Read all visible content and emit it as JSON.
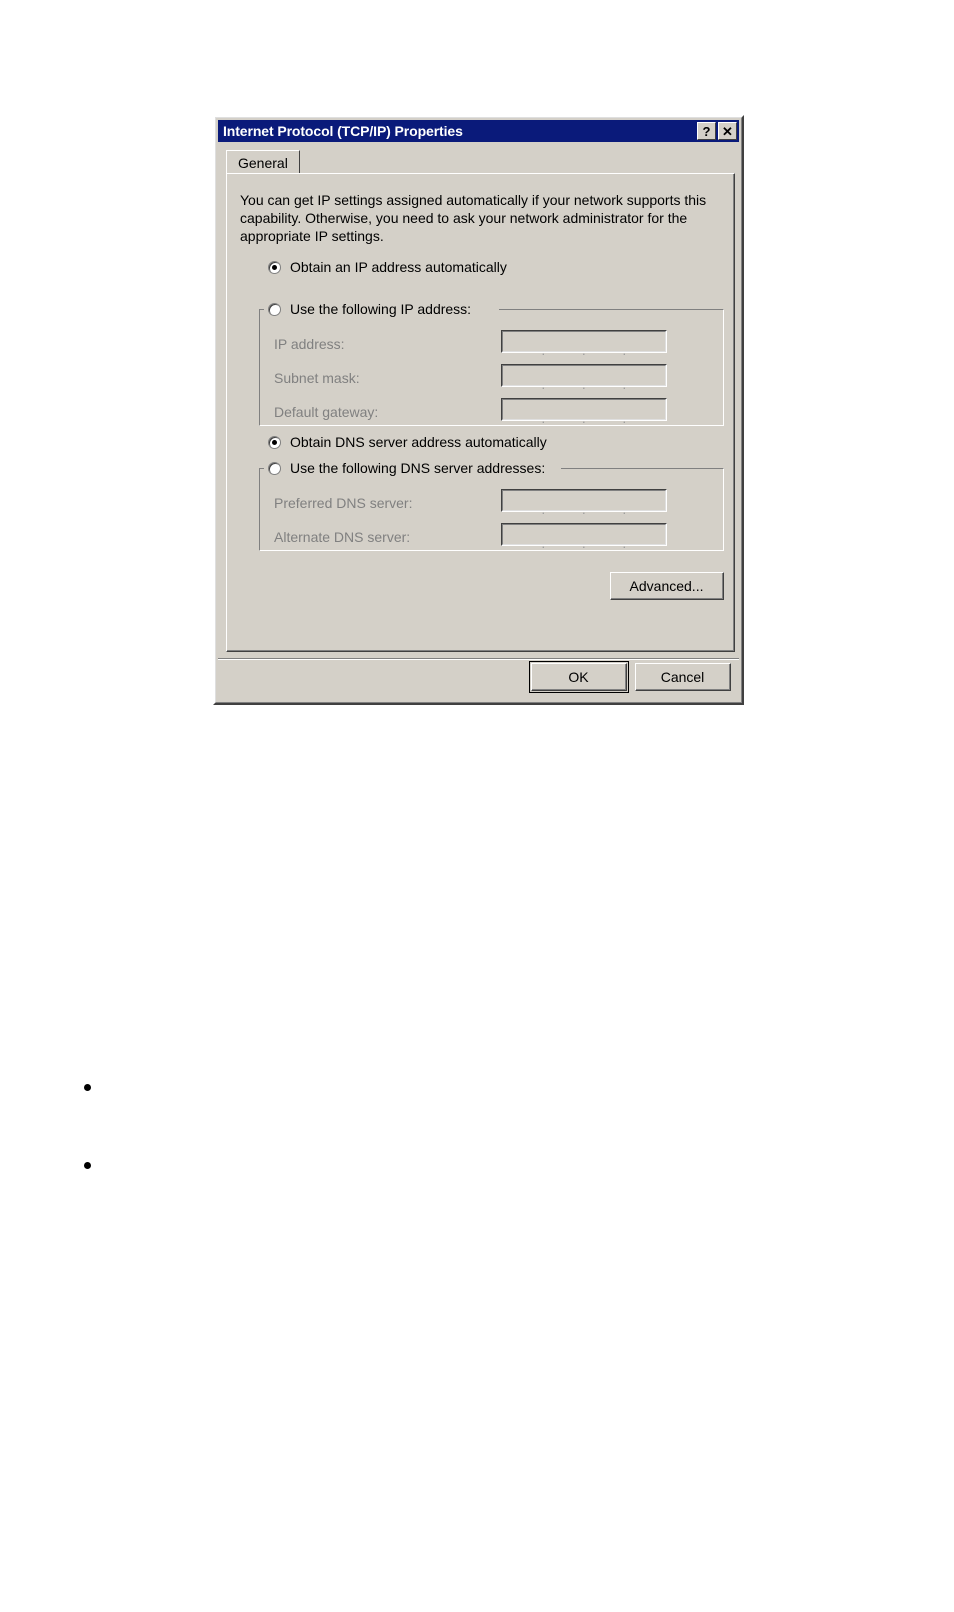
{
  "window": {
    "title": "Internet Protocol (TCP/IP) Properties",
    "help_button": "?",
    "close_button": "✕",
    "titlebar_color": "#0a1a7a",
    "face_color": "#d4d0c8"
  },
  "tabs": [
    {
      "label": "General",
      "selected": true
    }
  ],
  "general": {
    "intro": "You can get IP settings assigned automatically if your network supports this capability. Otherwise, you need to ask your network administrator for the appropriate IP settings.",
    "ip_mode": {
      "auto": {
        "label": "Obtain an IP address automatically",
        "selected": true
      },
      "manual": {
        "label": "Use the following IP address:",
        "selected": false
      }
    },
    "ip_fields": [
      {
        "label": "IP address:",
        "value": "",
        "disabled": true
      },
      {
        "label": "Subnet mask:",
        "value": "",
        "disabled": true
      },
      {
        "label": "Default gateway:",
        "value": "",
        "disabled": true
      }
    ],
    "dns_mode": {
      "auto": {
        "label": "Obtain DNS server address automatically",
        "selected": true
      },
      "manual": {
        "label": "Use the following DNS server addresses:",
        "selected": false
      }
    },
    "dns_fields": [
      {
        "label": "Preferred DNS server:",
        "value": "",
        "disabled": true
      },
      {
        "label": "Alternate DNS server:",
        "value": "",
        "disabled": true
      }
    ],
    "advanced_button": "Advanced..."
  },
  "footer": {
    "ok_button": "OK",
    "cancel_button": "Cancel"
  },
  "page": {
    "bullets": [
      "",
      ""
    ]
  }
}
